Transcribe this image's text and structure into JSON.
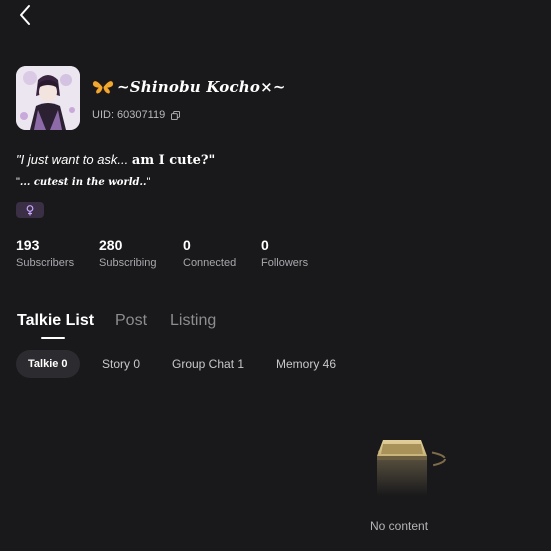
{
  "header": {
    "back_icon": "chevron-left-icon"
  },
  "profile": {
    "name": "~Shinobu Kocho×~",
    "name_icon": "butterfly-icon",
    "uid_label": "UID: 60307119",
    "copy_icon": "copy-icon",
    "bio_line_1_a": "\"I just want to ask... ",
    "bio_line_1_b": "am I cute?\"",
    "bio_line_2_open": "\"",
    "bio_line_2_fancy": "... cutest in the world..",
    "bio_line_2_close": "\"",
    "gender_icon": "female-icon",
    "accent_color": "#c8a6ff"
  },
  "stats": [
    {
      "value": "193",
      "label": "Subscribers"
    },
    {
      "value": "280",
      "label": "Subscribing"
    },
    {
      "value": "0",
      "label": "Connected"
    },
    {
      "value": "0",
      "label": "Followers"
    }
  ],
  "tabs": [
    {
      "label": "Talkie List",
      "active": true
    },
    {
      "label": "Post",
      "active": false
    },
    {
      "label": "Listing",
      "active": false
    }
  ],
  "filters": [
    {
      "label": "Talkie 0",
      "active": true
    },
    {
      "label": "Story 0",
      "active": false
    },
    {
      "label": "Group Chat 1",
      "active": false
    },
    {
      "label": "Memory 46",
      "active": false
    }
  ],
  "empty_state": {
    "icon": "empty-box-icon",
    "text": "No content"
  }
}
